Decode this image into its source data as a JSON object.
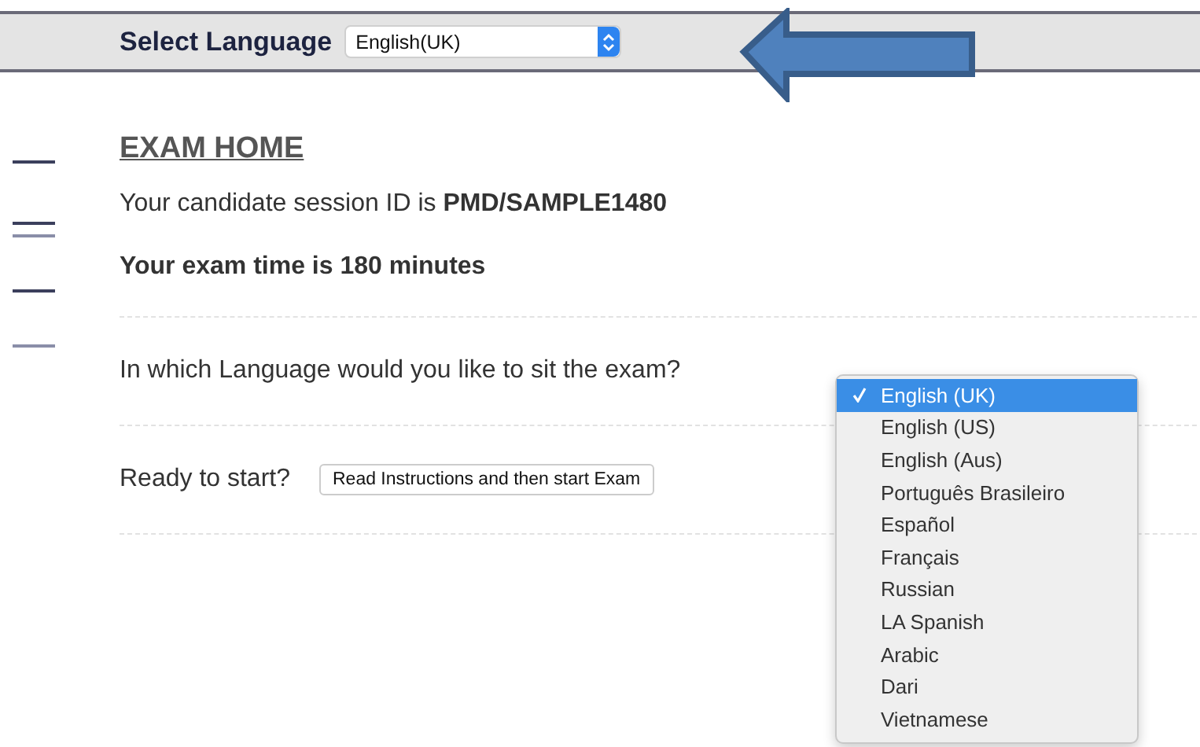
{
  "header": {
    "label": "Select Language",
    "select": {
      "value": "English(UK)"
    }
  },
  "heading": "EXAM HOME",
  "session_text": "Your candidate session ID is  **PMD/SAMPLE1480**",
  "time_text": "Your exam time is 180 minutes",
  "question": "In which Language would you like to sit the exam?",
  "ready": {
    "label": "Ready to start?",
    "button": "Read Instructions and then start Exam"
  },
  "language_menu": [
    {
      "label": "English (UK)",
      "selected": true
    },
    {
      "label": "English (US)",
      "selected": false
    },
    {
      "label": "English (Aus)",
      "selected": false
    },
    {
      "label": "Português Brasileiro",
      "selected": false
    },
    {
      "label": "Español",
      "selected": false
    },
    {
      "label": "Français",
      "selected": false
    },
    {
      "label": "Russian",
      "selected": false
    },
    {
      "label": "LA Spanish",
      "selected": false
    },
    {
      "label": "Arabic",
      "selected": false
    },
    {
      "label": "Dari",
      "selected": false
    },
    {
      "label": "Vietnamese",
      "selected": false
    }
  ]
}
